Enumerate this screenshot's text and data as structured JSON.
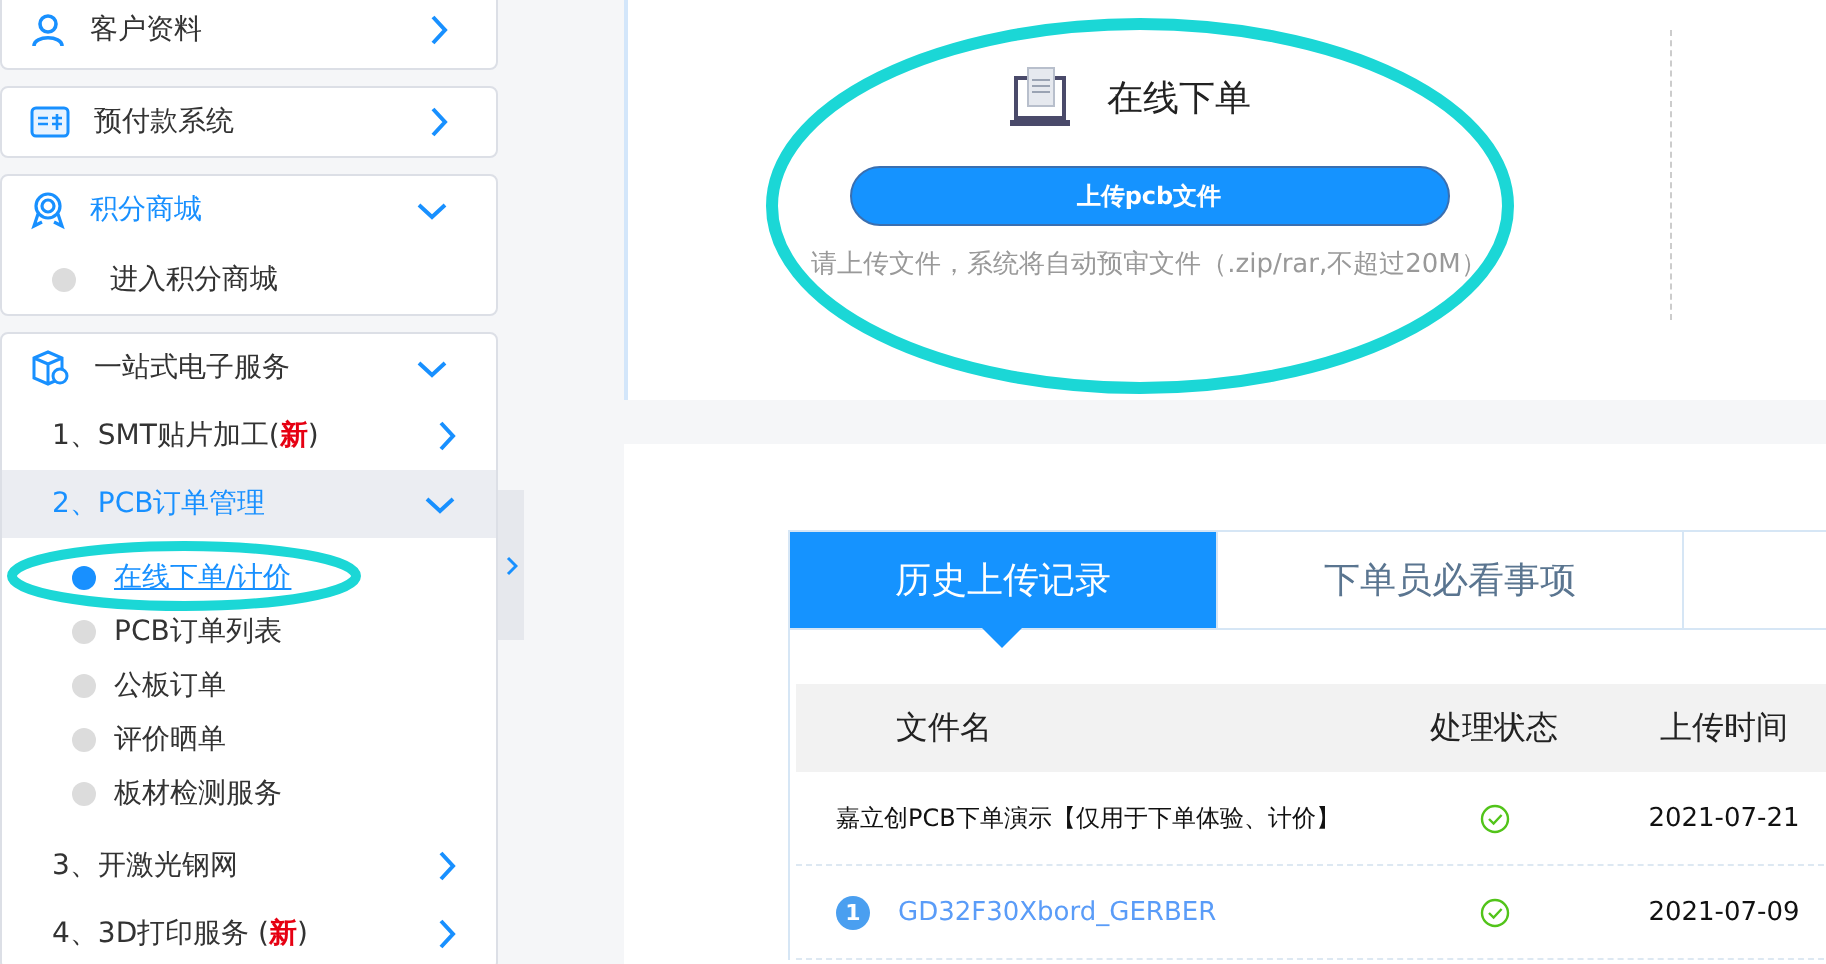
{
  "sidebar": {
    "groups": [
      {
        "label": "客户资料",
        "expanded": false,
        "selected": false
      },
      {
        "label": "预付款系统",
        "expanded": false,
        "selected": false
      },
      {
        "label": "积分商城",
        "expanded": true,
        "selected": true,
        "items": [
          {
            "kind": "leaf",
            "label": "进入积分商城",
            "selected": false
          }
        ]
      },
      {
        "label": "一站式电子服务",
        "expanded": true,
        "selected": false,
        "items": [
          {
            "kind": "branch",
            "label": "1、SMT贴片加工(",
            "badge": "新",
            "after": ")",
            "expanded": false,
            "selected": false
          },
          {
            "kind": "branch",
            "label": "2、PCB订单管理",
            "expanded": true,
            "selected": true,
            "children": [
              {
                "label": "在线下单/计价",
                "selected": true
              },
              {
                "label": "PCB订单列表",
                "selected": false
              },
              {
                "label": "公板订单",
                "selected": false
              },
              {
                "label": "评价晒单",
                "selected": false
              },
              {
                "label": "板材检测服务",
                "selected": false
              }
            ]
          },
          {
            "kind": "branch",
            "label": "3、开激光钢网",
            "expanded": false,
            "selected": false
          },
          {
            "kind": "branch",
            "label": "4、3D打印服务 (",
            "badge": "新",
            "after": ")",
            "expanded": false,
            "selected": false
          }
        ]
      }
    ]
  },
  "upload": {
    "title": "在线下单",
    "button": "上传pcb文件",
    "hint": "请上传文件，系统将自动预审文件（.zip/rar,不超过20M）"
  },
  "tabs": [
    {
      "label": "历史上传记录",
      "selected": true
    },
    {
      "label": "下单员必看事项",
      "selected": false
    }
  ],
  "table": {
    "columns": [
      "文件名",
      "处理状态",
      "上传时间"
    ],
    "rows": [
      {
        "kind": "demo",
        "name": "嘉立创PCB下单演示【仅用于下单体验、计价】",
        "processed": true,
        "time": "2021-07-21"
      },
      {
        "kind": "upload",
        "number": "1",
        "name": "GD32F30Xbord_GERBER",
        "processed": true,
        "time": "2021-07-09"
      }
    ]
  }
}
